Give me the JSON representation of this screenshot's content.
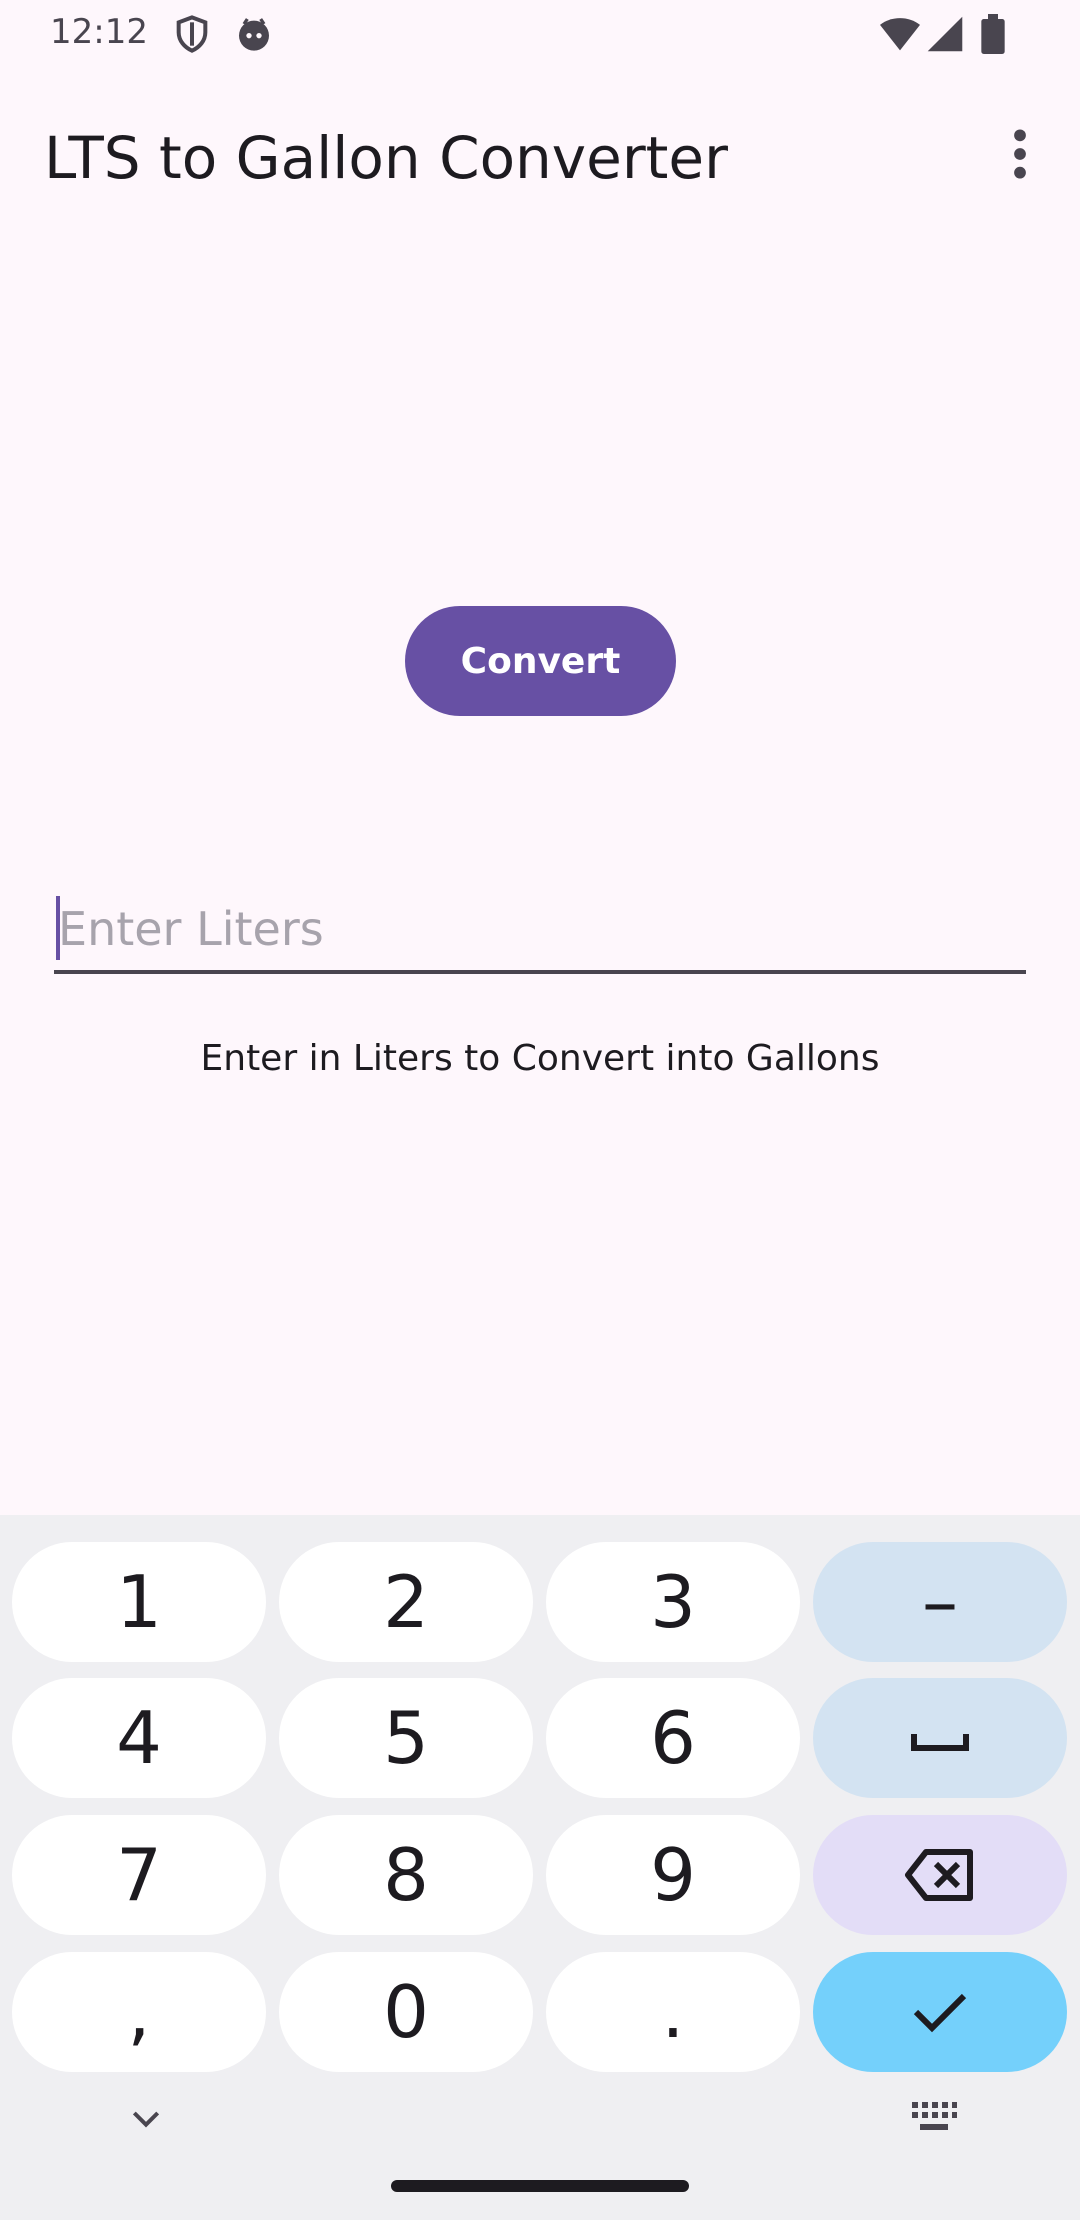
{
  "status_bar": {
    "time": "12:12"
  },
  "app_bar": {
    "title": "LTS to Gallon Converter"
  },
  "main": {
    "convert_label": "Convert",
    "input_placeholder": "Enter Liters",
    "input_value": "",
    "helper_text": "Enter in Liters to Convert into Gallons"
  },
  "keyboard": {
    "keys": {
      "k1": "1",
      "k2": "2",
      "k3": "3",
      "minus": "–",
      "k4": "4",
      "k5": "5",
      "k6": "6",
      "k7": "7",
      "k8": "8",
      "k9": "9",
      "comma": ",",
      "k0": "0",
      "period": "."
    }
  },
  "colors": {
    "background": "#FEF7FC",
    "primary": "#6750A4",
    "keyboard_bg": "#EFEFF2",
    "key_func": "#D3E3F2",
    "key_delete": "#E3DDF7",
    "key_done": "#74D0FB"
  },
  "icons": {
    "status": [
      "shield-icon",
      "app-notification-icon",
      "wifi-icon",
      "signal-icon",
      "battery-icon"
    ],
    "app_bar": [
      "more-vert-icon"
    ],
    "keyboard": [
      "space-icon",
      "backspace-icon",
      "check-icon",
      "chevron-down-icon",
      "keyboard-icon"
    ]
  }
}
